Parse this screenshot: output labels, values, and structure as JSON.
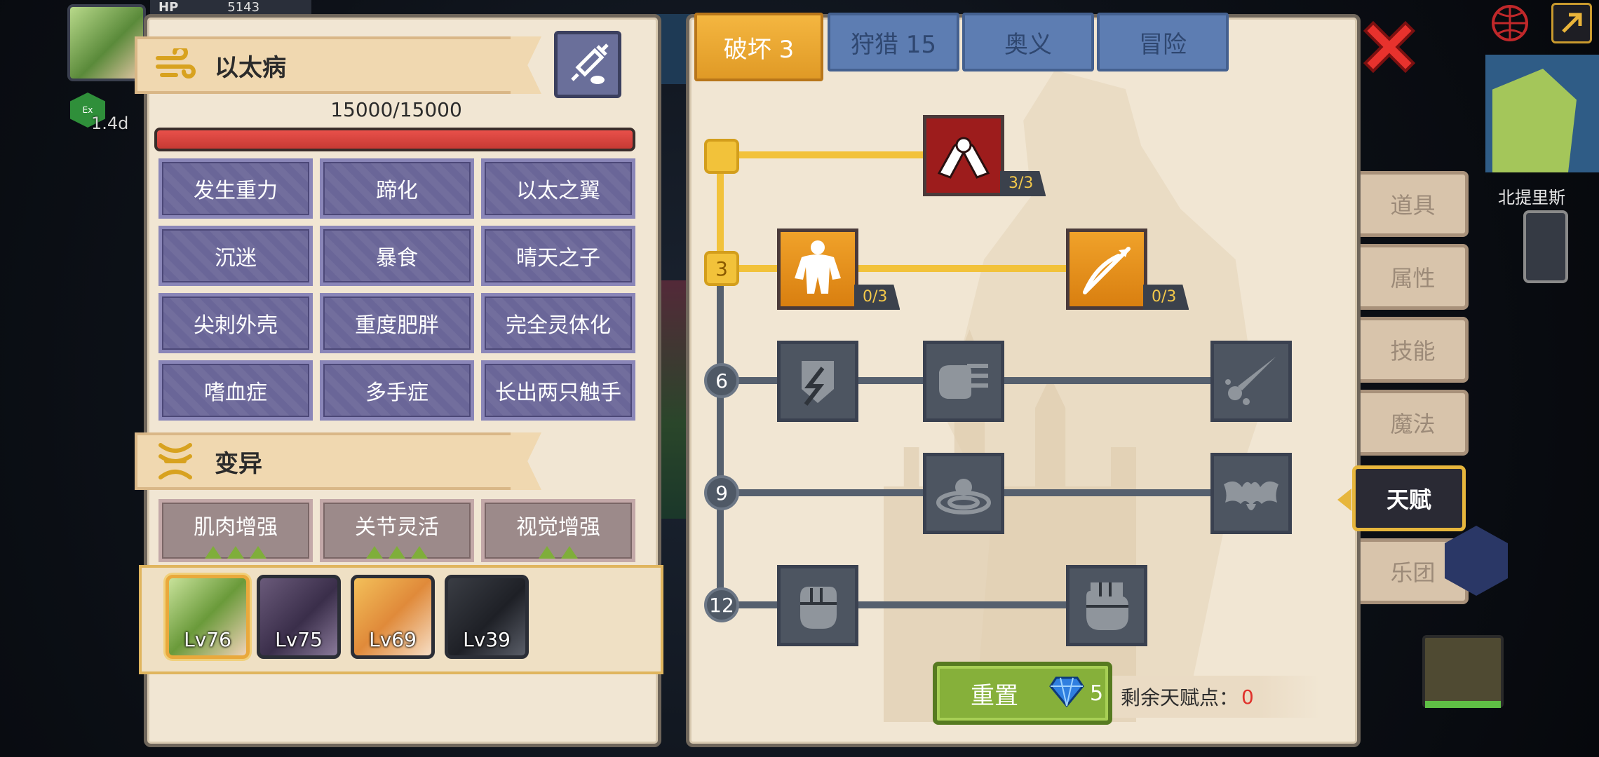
{
  "hud": {
    "hp_label": "HP",
    "hp_value": "5143",
    "exp_label": "1.4d"
  },
  "disease_panel": {
    "title": "以太病",
    "hp_text": "15000/15000",
    "hp_fraction": 1.0,
    "diseases": [
      "发生重力",
      "蹄化",
      "以太之翼",
      "沉迷",
      "暴食",
      "晴天之子",
      "尖刺外壳",
      "重度肥胖",
      "完全灵体化",
      "嗜血症",
      "多手症",
      "长出两只触手"
    ]
  },
  "mutation_panel": {
    "title": "变异",
    "mutations": [
      {
        "label": "肌肉增强",
        "level": 3
      },
      {
        "label": "关节灵活",
        "level": 3
      },
      {
        "label": "视觉增强",
        "level": 2
      }
    ]
  },
  "party": [
    {
      "level": "Lv76",
      "selected": true
    },
    {
      "level": "Lv75",
      "selected": false
    },
    {
      "level": "Lv69",
      "selected": false
    },
    {
      "level": "Lv39",
      "selected": false
    }
  ],
  "talent_tabs": [
    "破坏 3",
    "狩猎 15",
    "奥义",
    "冒险"
  ],
  "tree": {
    "levels": [
      "3",
      "6",
      "9",
      "12"
    ],
    "counts": {
      "arm_wrestle": "3/3",
      "body": "0/3",
      "arrow": "0/3"
    }
  },
  "reset": {
    "label": "重置",
    "cost": "5"
  },
  "points": {
    "label": "剩余天赋点：",
    "value": "0"
  },
  "side_tabs": [
    "道具",
    "属性",
    "技能",
    "魔法",
    "天赋",
    "乐团"
  ],
  "location": "北提里斯",
  "colors": {
    "accent": "#f2c23a",
    "tab": "#5d7db2",
    "disease_cell": "#6a6698",
    "reset": "#86b03a",
    "points_value": "#e0312b"
  }
}
